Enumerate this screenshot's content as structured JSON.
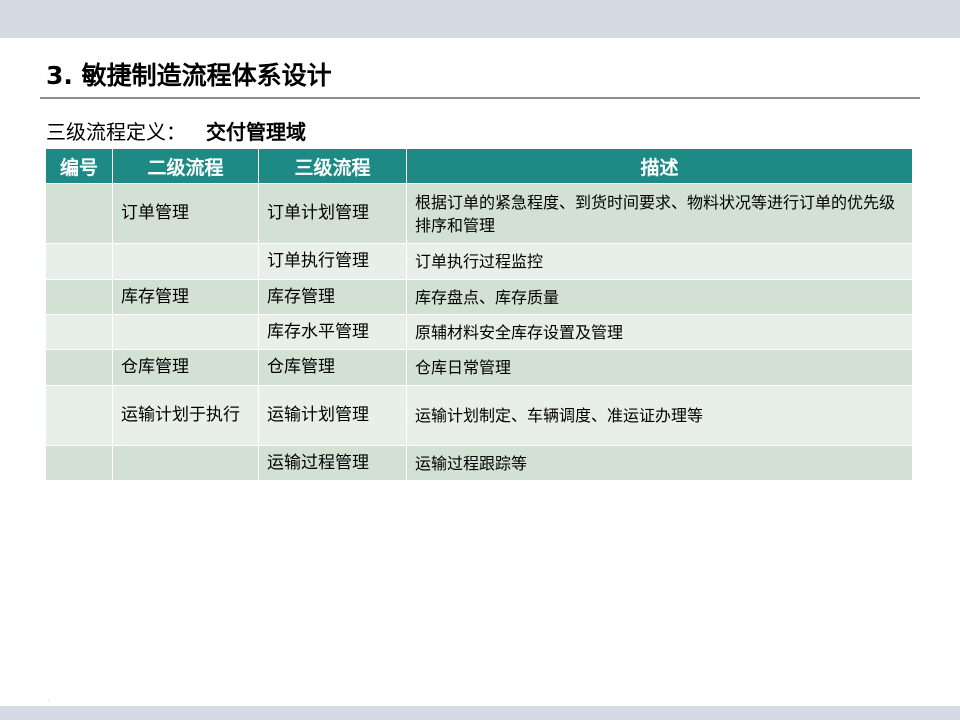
{
  "slide": {
    "title": "3. 敏捷制造流程体系设计",
    "subtitle_lead": "三级流程定义：",
    "subtitle_domain": "交付管理域"
  },
  "table": {
    "headers": [
      "编号",
      "二级流程",
      "三级流程",
      "描述"
    ],
    "rows": [
      {
        "num": "",
        "level2": "订单管理",
        "level3": "订单计划管理",
        "desc": "根据订单的紧急程度、到货时间要求、物料状况等进行订单的优先级排序和管理"
      },
      {
        "num": "",
        "level2": "",
        "level3": "订单执行管理",
        "desc": "订单执行过程监控"
      },
      {
        "num": "",
        "level2": "库存管理",
        "level3": "库存管理",
        "desc": "库存盘点、库存质量"
      },
      {
        "num": "",
        "level2": "",
        "level3": "库存水平管理",
        "desc": "原辅材料安全库存设置及管理"
      },
      {
        "num": "",
        "level2": "仓库管理",
        "level3": "仓库管理",
        "desc": "仓库日常管理"
      },
      {
        "num": "",
        "level2": "运输计划于执行",
        "level3": "运输计划管理",
        "desc": "运输计划制定、车辆调度、准运证办理等"
      },
      {
        "num": "",
        "level2": "",
        "level3": "运输过程管理",
        "desc": "运输过程跟踪等"
      }
    ]
  },
  "footer": {
    "mark": "."
  },
  "colors": {
    "header_bg": "#1e8a86",
    "row_dark": "#d2e1d3",
    "row_light": "#e8efe9",
    "band": "#d5dae4"
  }
}
